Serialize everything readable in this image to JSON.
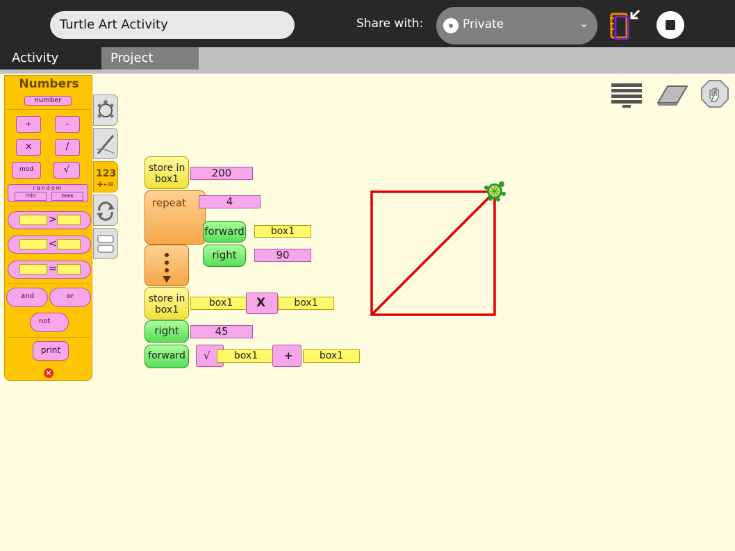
{
  "toolbar": {
    "title": "Turtle Art Activity",
    "share_label": "Share with:",
    "share_value": "Private",
    "keep_icon": "journal-keep-icon",
    "stop_icon": "stop-icon"
  },
  "tabs": [
    {
      "label": "Activity",
      "active": true
    },
    {
      "label": "Project",
      "active": false
    }
  ],
  "palette": {
    "title": "Numbers",
    "number_label": "number",
    "plus": "+",
    "minus": "-",
    "times": "×",
    "divide": "/",
    "mod": "mod",
    "sqrt": "√",
    "random": "random",
    "min": "min",
    "max": "max",
    "greater": ">",
    "less": "<",
    "equal": "=",
    "and": "and",
    "or": "or",
    "not": "not",
    "print": "print",
    "categories": [
      "turtle-icon",
      "pen-icon",
      "numbers-icon",
      "flow-icon",
      "blocks-icon"
    ]
  },
  "right_icons": [
    "hide-blocks-icon",
    "eraser-icon",
    "stop-turtle-icon"
  ],
  "program": {
    "store1_label": "store in box1",
    "store1_value": "200",
    "repeat_label": "repeat",
    "repeat_value": "4",
    "forward1_label": "forward",
    "forward1_value": "box1",
    "right1_label": "right",
    "right1_value": "90",
    "store2_label": "store in box1",
    "store2_left": "box1",
    "store2_op": "X",
    "store2_right": "box1",
    "right2_label": "right",
    "right2_value": "45",
    "forward2_label": "forward",
    "forward2_sqrt": "√",
    "forward2_left": "box1",
    "forward2_op": "+",
    "forward2_right": "box1"
  },
  "colors": {
    "toolbar": "#282828",
    "canvas": "#fffce0",
    "palette": "#fec503",
    "pen": "#e00000",
    "turtle": "#2a9a2a"
  }
}
